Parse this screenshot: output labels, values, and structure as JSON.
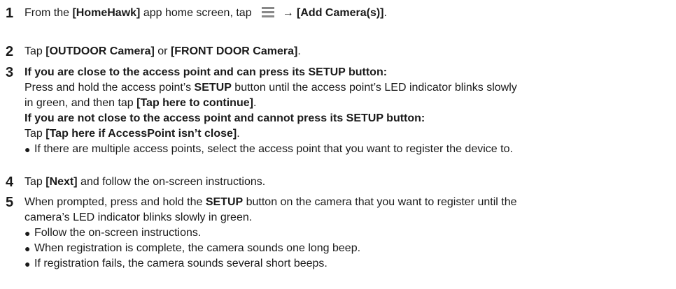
{
  "steps": [
    {
      "number": "1",
      "s1_a": "From the ",
      "s1_b": "[HomeHawk]",
      "s1_c": " app home screen, tap",
      "s1_arrow": "→",
      "s1_d": "[Add Camera(s)]",
      "s1_e": ".",
      "menu_icon": "hamburger-menu-icon"
    },
    {
      "number": "2",
      "s2_a": "Tap ",
      "s2_b": "[OUTDOOR Camera]",
      "s2_c": " or ",
      "s2_d": "[FRONT DOOR Camera]",
      "s2_e": "."
    },
    {
      "number": "3",
      "heading1": "If you are close to the access point and can press its SETUP button:",
      "l2_a": "Press and hold the access point’s ",
      "l2_b": "SETUP",
      "l2_c": " button until the access point’s LED indicator blinks slowly",
      "l3_a": "in green, and then tap ",
      "l3_b": "[Tap here to continue]",
      "l3_c": ".",
      "heading2": "If you are not close to the access point and cannot press its SETUP button:",
      "l5_a": "Tap ",
      "l5_b": "[Tap here if AccessPoint isn’t close]",
      "l5_c": ".",
      "bullet1": "If there are multiple access points, select the access point that you want to register the device to."
    },
    {
      "number": "4",
      "s4_a": "Tap ",
      "s4_b": "[Next]",
      "s4_c": " and follow the on-screen instructions."
    },
    {
      "number": "5",
      "l1_a": "When prompted, press and hold the ",
      "l1_b": "SETUP",
      "l1_c": " button on the camera that you want to register until the",
      "l2": "camera’s LED indicator blinks slowly in green.",
      "bullets": [
        "Follow the on-screen instructions.",
        "When registration is complete, the camera sounds one long beep.",
        "If registration fails, the camera sounds several short beeps."
      ]
    }
  ],
  "bullet_glyph": "●"
}
